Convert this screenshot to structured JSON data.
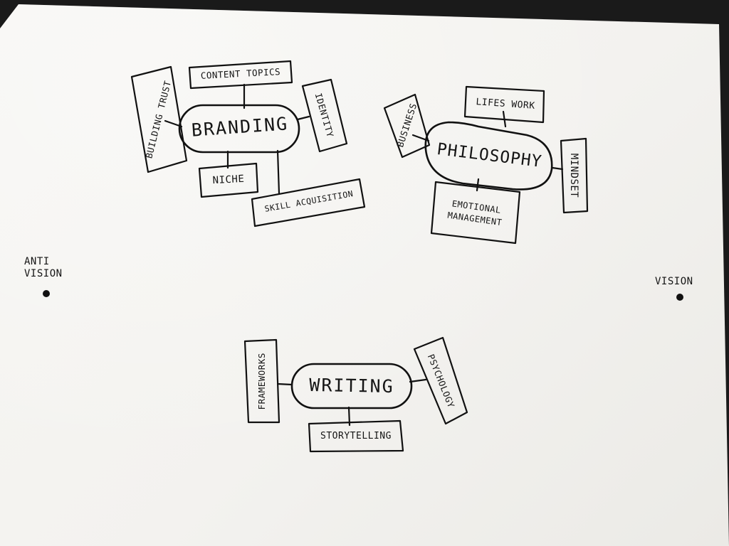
{
  "clusters": [
    {
      "hub": "BRANDING",
      "branches": [
        "CONTENT TOPICS",
        "IDENTITY",
        "BUILDING TRUST",
        "NICHE",
        "SKILL ACQUISITION"
      ]
    },
    {
      "hub": "PHILOSOPHY",
      "branches": [
        "LIFES WORK",
        "BUSINESS",
        "MINDSET",
        "EMOTIONAL MANAGEMENT"
      ]
    },
    {
      "hub": "WRITING",
      "branches": [
        "FRAMEWORKS",
        "PSYCHOLOGY",
        "STORYTELLING"
      ]
    }
  ],
  "markers": {
    "anti_vision": [
      "ANTI",
      "VISION"
    ],
    "vision": "VISION"
  },
  "colors": {
    "paper": "#f5f4f1",
    "ink": "#111111",
    "background": "#1a1a1a"
  }
}
